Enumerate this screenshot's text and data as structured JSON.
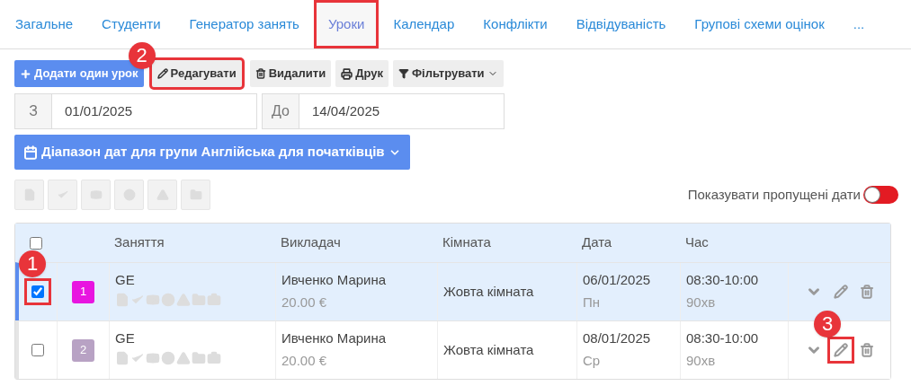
{
  "tabs": [
    {
      "label": "Загальне",
      "selected": false,
      "highlighted": false
    },
    {
      "label": "Студенти",
      "selected": false,
      "highlighted": false
    },
    {
      "label": "Генератор занять",
      "selected": false,
      "highlighted": false
    },
    {
      "label": "Уроки",
      "selected": true,
      "highlighted": true
    },
    {
      "label": "Календар",
      "selected": false,
      "highlighted": false
    },
    {
      "label": "Конфлікти",
      "selected": false,
      "highlighted": false
    },
    {
      "label": "Відвідуваність",
      "selected": false,
      "highlighted": false
    },
    {
      "label": "Групові схеми оцінок",
      "selected": false,
      "highlighted": false
    },
    {
      "label": "...",
      "selected": false,
      "highlighted": false
    }
  ],
  "toolbar": [
    {
      "kind": "add",
      "label": "Додати один урок",
      "primary": true,
      "highlighted": false
    },
    {
      "kind": "edit",
      "label": "Редагувати",
      "primary": false,
      "highlighted": true,
      "callout": "2"
    },
    {
      "kind": "delete",
      "label": "Видалити",
      "primary": false,
      "highlighted": false
    },
    {
      "kind": "print",
      "label": "Друк",
      "primary": false,
      "highlighted": false
    },
    {
      "kind": "filter",
      "label": "Фільтрувати",
      "primary": false,
      "highlighted": false
    }
  ],
  "date_from": {
    "label": "З",
    "value": "01/01/2025"
  },
  "date_to": {
    "label": "До",
    "value": "14/04/2025"
  },
  "range_button": "Діапазон дат для групи Англійська для початківців",
  "show_skipped_dates": {
    "label": "Показувати пропущені дати",
    "on": false
  },
  "table": {
    "select_all_checked": false,
    "columns": [
      "Заняття",
      "Викладач",
      "Кімната",
      "Дата",
      "Час"
    ],
    "rows": [
      {
        "number": "1",
        "color": "#e815e0",
        "selected": true,
        "checkbox_highlighted": true,
        "checkbox_callout": "1",
        "lesson": "GE",
        "teacher": "Ивченко Марина",
        "price": "20.00 €",
        "room": "Жовта кімната",
        "date": "06/01/2025",
        "weekday": "Пн",
        "time": "08:30-10:00",
        "duration": "90хв",
        "edit_highlighted": false
      },
      {
        "number": "2",
        "color": "#b8a2c4",
        "selected": false,
        "checkbox_highlighted": false,
        "lesson": "GE",
        "teacher": "Ивченко Марина",
        "price": "20.00 €",
        "room": "Жовта кімната",
        "date": "08/01/2025",
        "weekday": "Ср",
        "time": "08:30-10:00",
        "duration": "90хв",
        "edit_highlighted": true,
        "edit_callout": "3"
      }
    ]
  }
}
